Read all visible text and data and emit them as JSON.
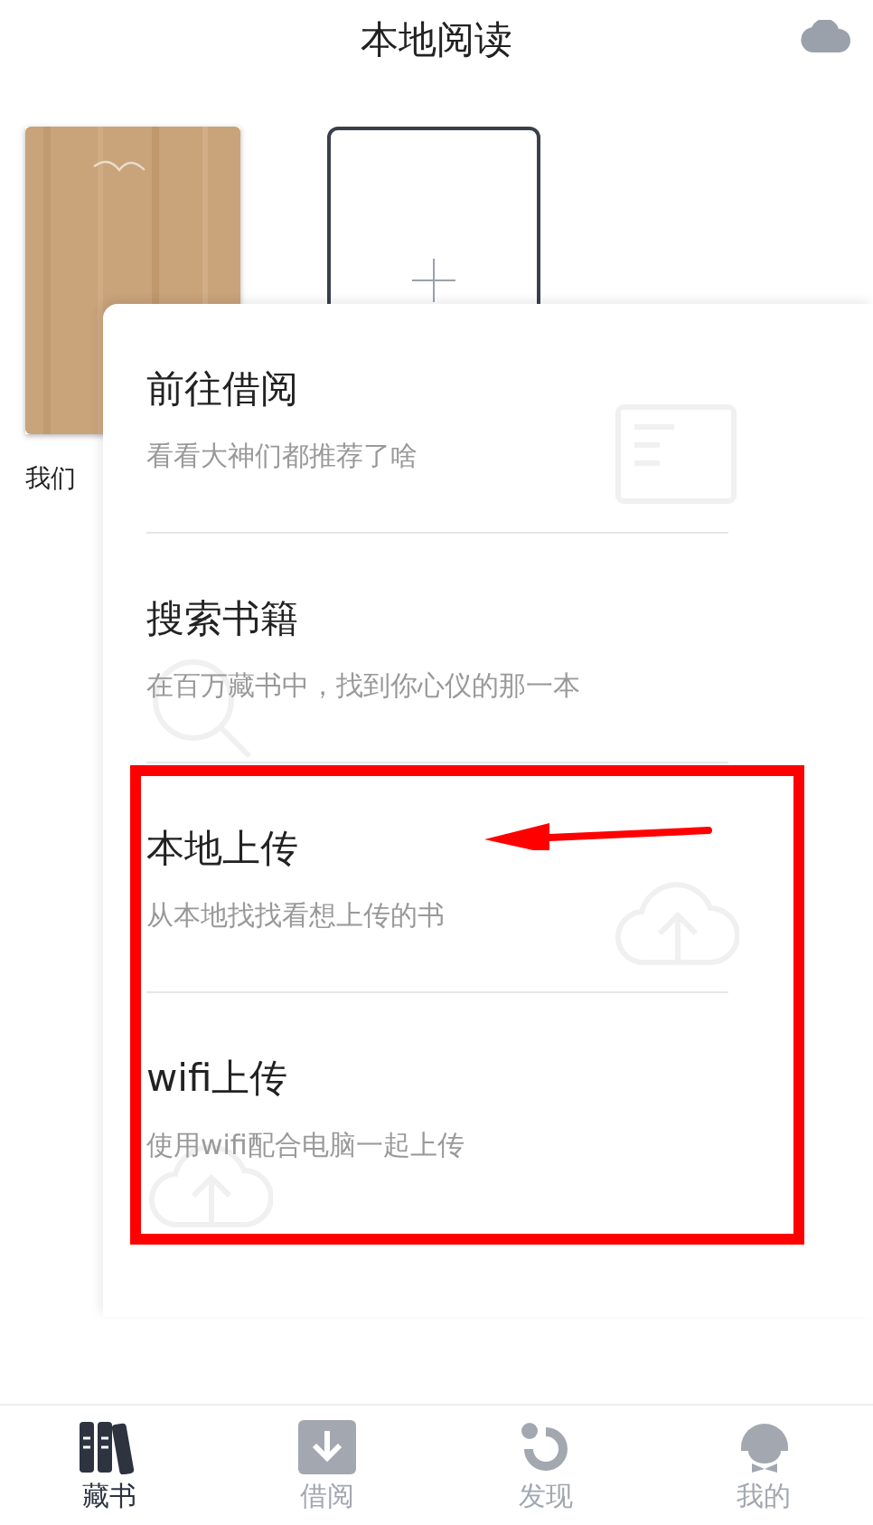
{
  "header": {
    "title": "本地阅读"
  },
  "books": [
    {
      "kind": "picture",
      "title": "我们"
    }
  ],
  "add_book": {
    "kind": "add"
  },
  "menu": [
    {
      "kind": "borrow",
      "title": "前往借阅",
      "subtitle": "看看大神们都推荐了啥"
    },
    {
      "kind": "search",
      "title": "搜索书籍",
      "subtitle": "在百万藏书中，找到你心仪的那一本"
    },
    {
      "kind": "upload",
      "title": "本地上传",
      "subtitle": "从本地找找看想上传的书"
    },
    {
      "kind": "wifi",
      "title": "wifi上传",
      "subtitle": "使用wifi配合电脑一起上传"
    }
  ],
  "tabs": [
    {
      "kind": "shelf",
      "label": "藏书",
      "selected": true
    },
    {
      "kind": "borrow",
      "label": "借阅",
      "selected": false
    },
    {
      "kind": "discover",
      "label": "发现",
      "selected": false
    },
    {
      "kind": "me",
      "label": "我的",
      "selected": false
    }
  ]
}
